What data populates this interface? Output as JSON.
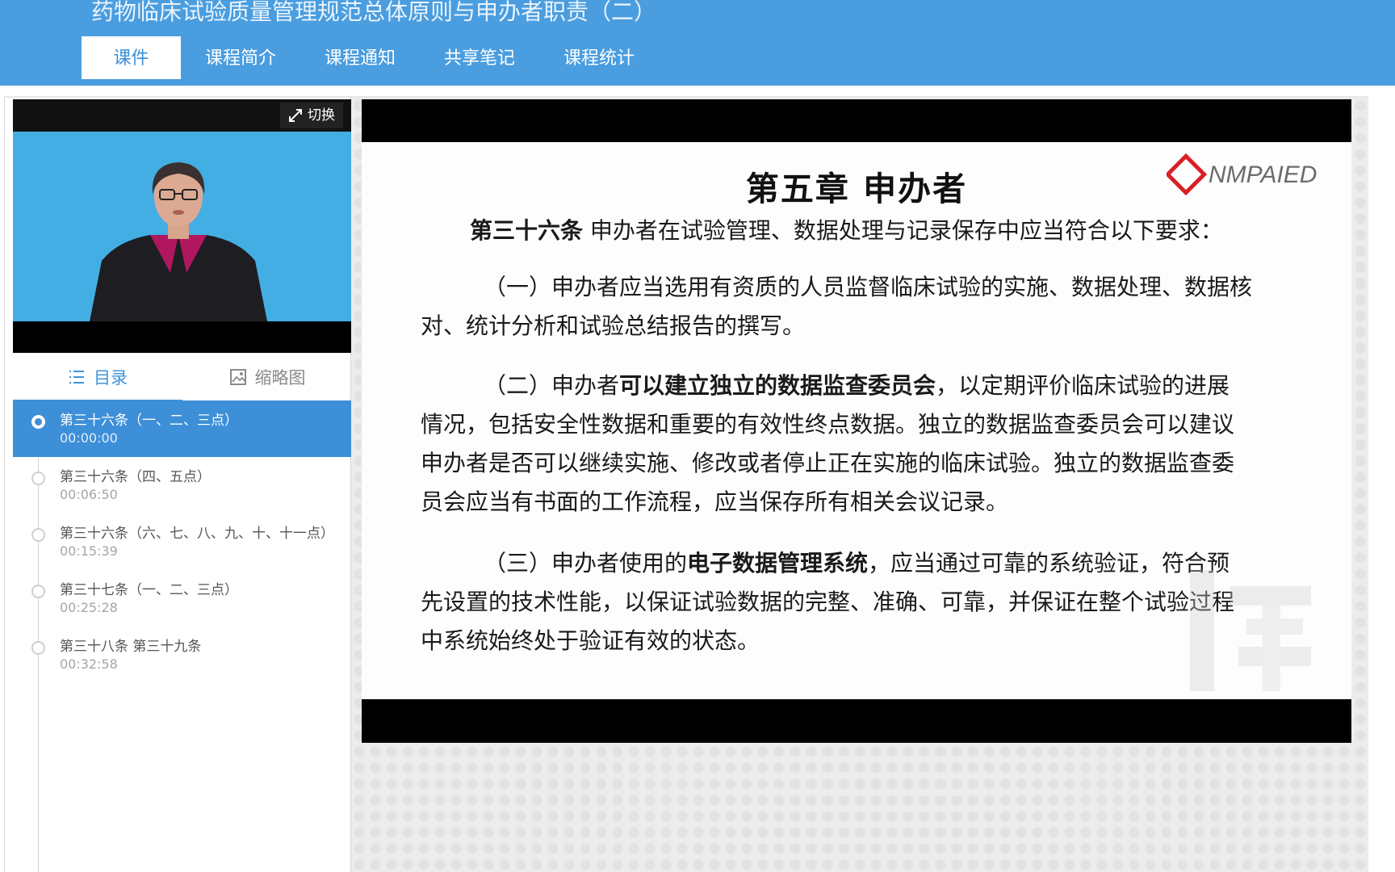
{
  "header": {
    "course_title": "药物临床试验质量管理规范总体原则与申办者职责（二）",
    "tabs": [
      {
        "label": "课件",
        "active": true
      },
      {
        "label": "课程简介",
        "active": false
      },
      {
        "label": "课程通知",
        "active": false
      },
      {
        "label": "共享笔记",
        "active": false
      },
      {
        "label": "课程统计",
        "active": false
      }
    ]
  },
  "video": {
    "switch_label": "切换",
    "switch_icon": "expand-arrows-icon"
  },
  "side_tabs": {
    "catalog_label": "目录",
    "catalog_icon": "list-icon",
    "thumbnail_label": "缩略图",
    "thumbnail_icon": "image-icon"
  },
  "catalog": [
    {
      "label": "第三十六条（一、二、三点）",
      "time": "00:00:00",
      "active": true
    },
    {
      "label": "第三十六条（四、五点）",
      "time": "00:06:50",
      "active": false
    },
    {
      "label": "第三十六条（六、七、八、九、十、十一点）",
      "time": "00:15:39",
      "active": false
    },
    {
      "label": "第三十七条（一、二、三点）",
      "time": "00:25:28",
      "active": false
    },
    {
      "label": "第三十八条 第三十九条",
      "time": "00:32:58",
      "active": false
    }
  ],
  "slide": {
    "title": "第五章  申办者",
    "logo_text": "NMPAIED",
    "intro_bold": "第三十六条",
    "intro_text": "  申办者在试验管理、数据处理与记录保存中应当符合以下要求：",
    "p1": "（一）申办者应当选用有资质的人员监督临床试验的实施、数据处理、数据核对、统计分析和试验总结报告的撰写。",
    "p2_pre": "（二）申办者",
    "p2_bold": "可以建立独立的数据监查委员会",
    "p2_post": "，以定期评价临床试验的进展情况，包括安全性数据和重要的有效性终点数据。独立的数据监查委员会可以建议申办者是否可以继续实施、修改或者停止正在实施的临床试验。独立的数据监查委员会应当有书面的工作流程，应当保存所有相关会议记录。",
    "p3_pre": "（三）申办者使用的",
    "p3_bold": "电子数据管理系统",
    "p3_post": "，应当通过可靠的系统验证，符合预先设置的技术性能，以保证试验数据的完整、准确、可靠，并保证在整个试验过程中系统始终处于验证有效的状态。"
  },
  "colors": {
    "header_bg": "#4a9ddf",
    "active_item": "#3d8fd8",
    "accent": "#3f94d9"
  }
}
